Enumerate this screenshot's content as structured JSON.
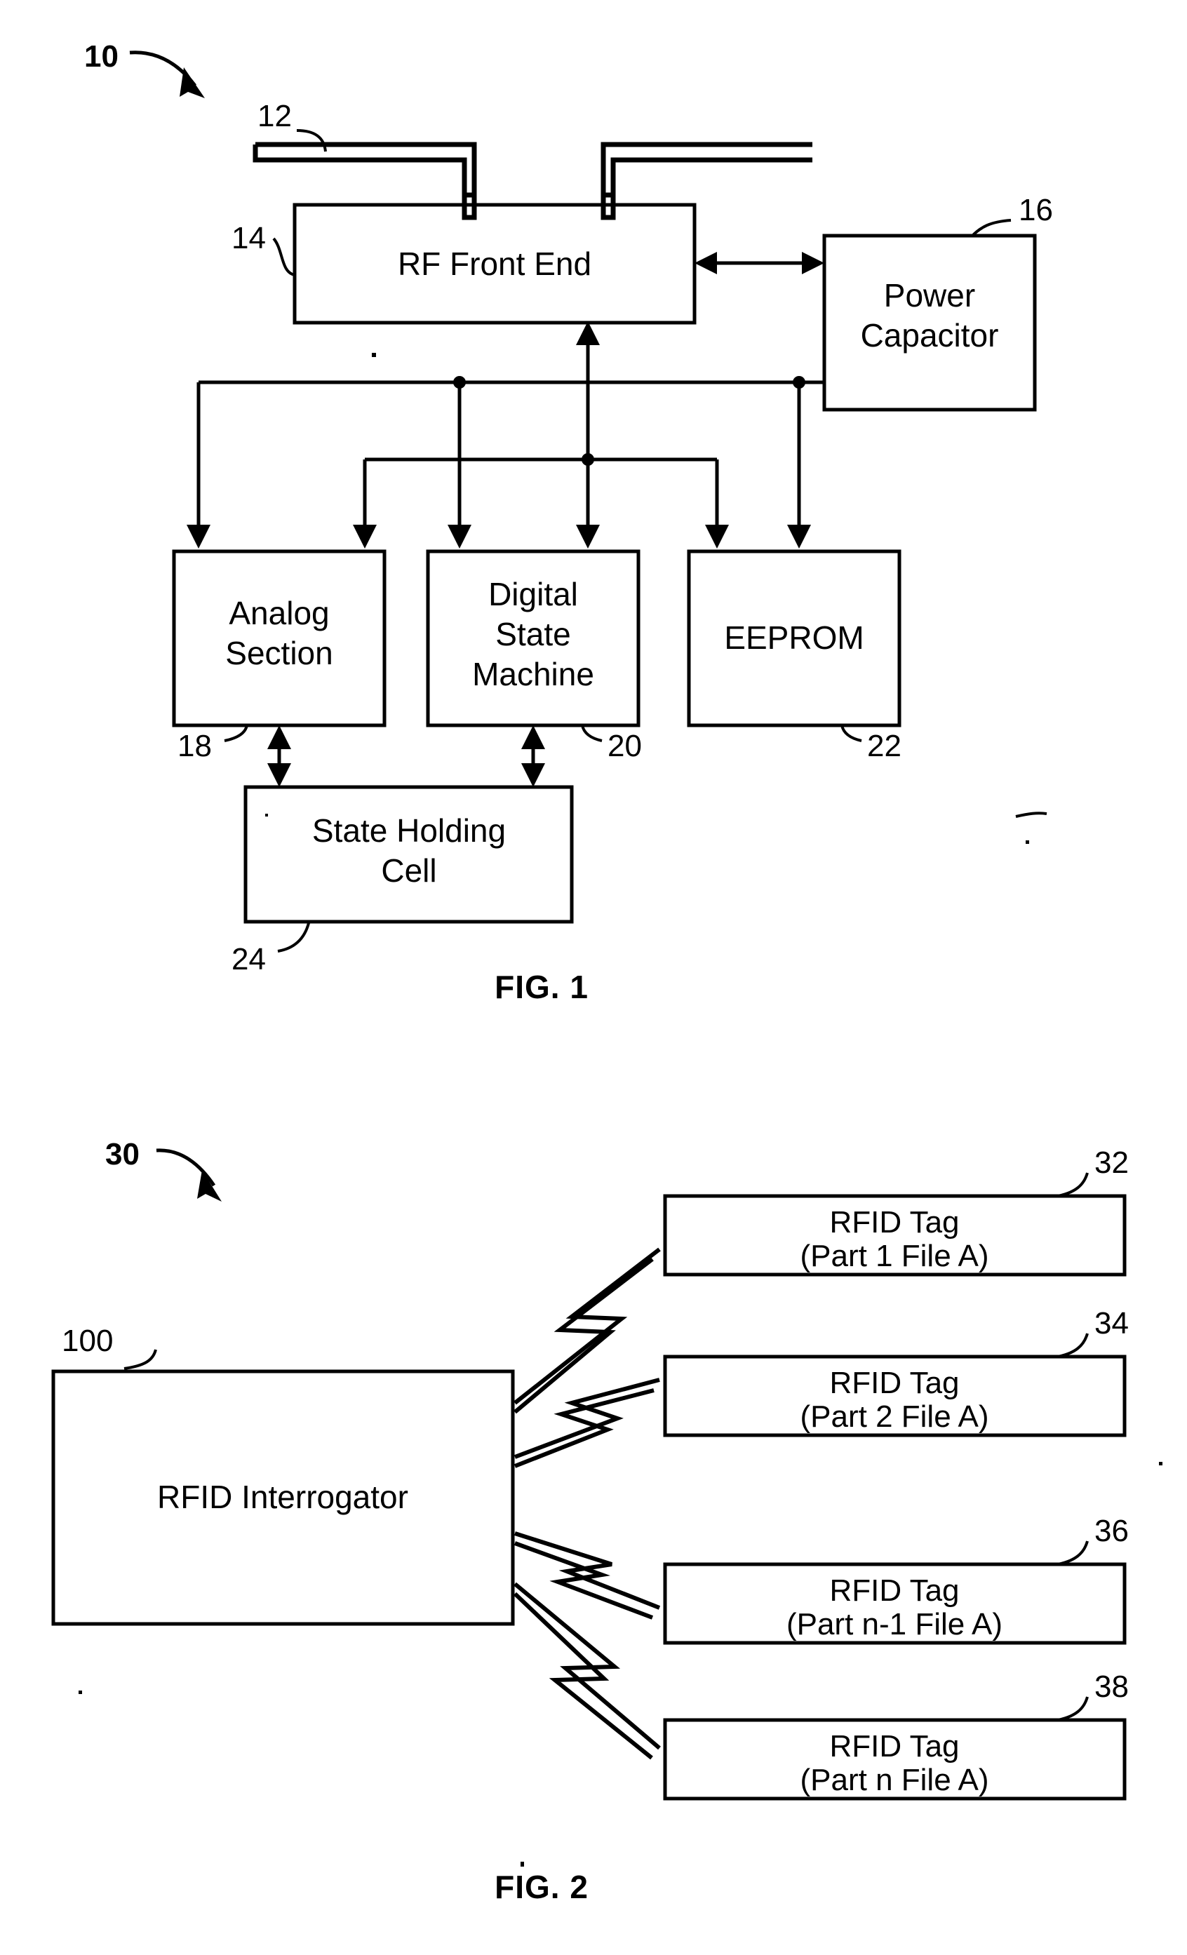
{
  "figures": [
    {
      "id": "fig1",
      "caption": "FIG. 1",
      "assembly_ref": "10",
      "blocks": {
        "antenna": {
          "ref": "12",
          "label": ""
        },
        "rf_front_end": {
          "ref": "14",
          "label": "RF Front End"
        },
        "power_capacitor": {
          "ref": "16",
          "line1": "Power",
          "line2": "Capacitor"
        },
        "analog_section": {
          "ref": "18",
          "line1": "Analog",
          "line2": "Section"
        },
        "digital_state_machine": {
          "ref": "20",
          "line1": "Digital",
          "line2": "State",
          "line3": "Machine"
        },
        "eeprom": {
          "ref": "22",
          "label": "EEPROM"
        },
        "state_holding_cell": {
          "ref": "24",
          "line1": "State Holding",
          "line2": "Cell"
        }
      }
    },
    {
      "id": "fig2",
      "caption": "FIG. 2",
      "assembly_ref": "30",
      "interrogator": {
        "ref": "100",
        "label": "RFID Interrogator"
      },
      "tags": [
        {
          "ref": "32",
          "line1": "RFID Tag",
          "line2": "(Part 1 File A)"
        },
        {
          "ref": "34",
          "line1": "RFID Tag",
          "line2": "(Part 2 File A)"
        },
        {
          "ref": "36",
          "line1": "RFID Tag",
          "line2": "(Part n-1 File A)"
        },
        {
          "ref": "38",
          "line1": "RFID Tag",
          "line2": "(Part n File A)"
        }
      ]
    }
  ],
  "colors": {
    "ink": "#000000",
    "paper": "#ffffff"
  }
}
